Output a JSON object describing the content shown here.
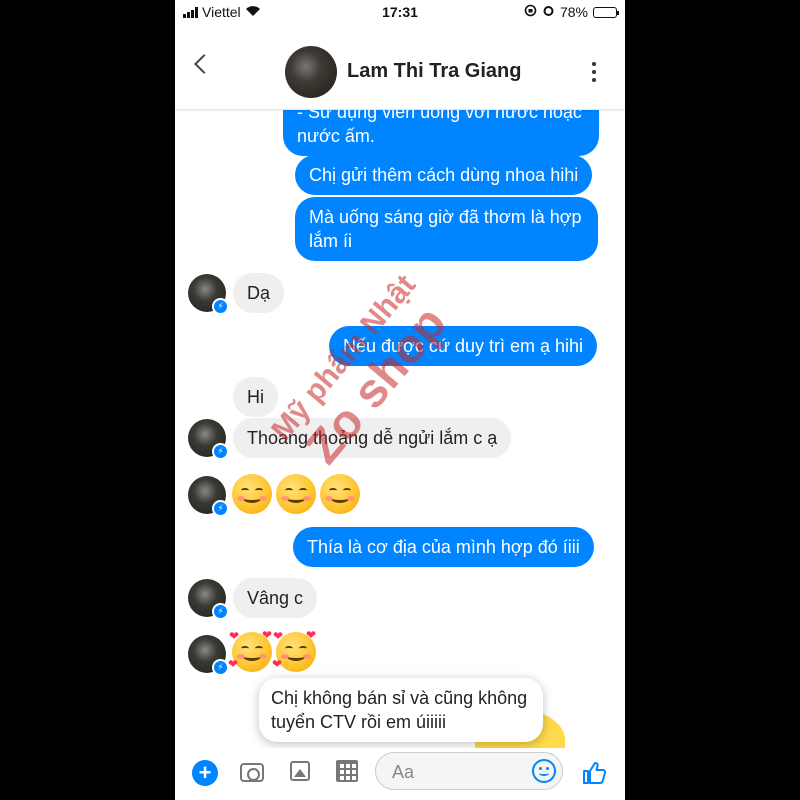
{
  "status": {
    "carrier": "Viettel",
    "time": "17:31",
    "battery": "78%",
    "battery_level": 0.78
  },
  "header": {
    "name": "Lam Thi Tra Giang"
  },
  "messages": {
    "m1": "- Sử dụng viên uống với nước hoặc nước ấm.",
    "m2": "Chị gửi thêm cách dùng nhoa hihi",
    "m3": "Mà uống sáng giờ đã thơm là hợp lắm íi",
    "m4": "Dạ",
    "m5": "Nếu được cứ duy trì em ạ hihi",
    "m6": "Hi",
    "m7": "Thoang thoảng dễ ngửi lắm c ạ",
    "m8": "Thía là cơ địa của mình hợp đó íiii",
    "m9": "Vâng c",
    "popup": "Chị không bán sỉ và cũng không tuyển CTV rồi em úiiiii"
  },
  "watermark": {
    "line1": "Mỹ phẩm Nhật",
    "line2": "Zo shop"
  },
  "composer": {
    "placeholder": "Aa"
  },
  "icons": [
    "signal-icon",
    "wifi-icon",
    "alarm-icon",
    "battery-icon",
    "back-icon",
    "more-icon",
    "messenger-badge-icon",
    "plus-icon",
    "camera-icon",
    "photo-icon",
    "grid-icon",
    "emoji-icon",
    "like-icon"
  ],
  "colors": {
    "accent": "#0084ff",
    "incoming_bubble": "#efefef",
    "watermark": "#c82828"
  }
}
